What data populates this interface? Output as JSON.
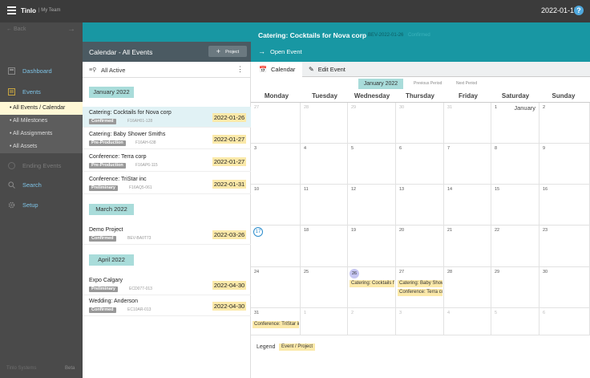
{
  "topbar": {
    "app_name": "Tinlo",
    "team": "| My Team",
    "date": "2022-01-17",
    "help": "?"
  },
  "sidebar": {
    "back": "Back",
    "items": [
      {
        "label": "Dashboard"
      },
      {
        "label": "Events"
      },
      {
        "label": "Ending Events"
      },
      {
        "label": "Search"
      },
      {
        "label": "Setup"
      }
    ],
    "subitems": [
      {
        "label": "All Events / Calendar"
      },
      {
        "label": "All Milestones"
      },
      {
        "label": "All Assignments"
      },
      {
        "label": "All Assets"
      }
    ],
    "footer_left": "Tinlo Systems",
    "footer_right": "Beta"
  },
  "banner": {
    "title": "Catering: Cocktails for Nova corp",
    "sub1": "BEV-2022-01-26",
    "sub2": "Confirmed",
    "open_label": "Open Event"
  },
  "list": {
    "title": "Calendar - All Events",
    "project_button": "Project",
    "filter_label": "All Active",
    "groups": [
      {
        "month": "January 2022",
        "events": [
          {
            "name": "Catering: Cocktails for Nova corp",
            "status": "Confirmed",
            "code": "F16AH01-128",
            "date": "2022-01-26"
          },
          {
            "name": "Catering: Baby Shower Smiths",
            "status": "Pre-Production",
            "code": "F16AH-638",
            "date": "2022-01-27"
          },
          {
            "name": "Conference: Terra corp",
            "status": "Pre-Production",
            "code": "F16AP6-115",
            "date": "2022-01-27"
          },
          {
            "name": "Conference: TriStar inc",
            "status": "Preliminary",
            "code": "F16AQ5-061",
            "date": "2022-01-31"
          }
        ]
      },
      {
        "month": "March 2022",
        "events": [
          {
            "name": "Demo Project",
            "status": "Confirmed",
            "code": "BEV-BA0T73",
            "date": "2022-03-26"
          }
        ]
      },
      {
        "month": "April 2022",
        "events": [
          {
            "name": "Expo Calgary",
            "status": "Preliminary",
            "code": "ECD077-013",
            "date": "2022-04-30"
          },
          {
            "name": "Wedding: Anderson",
            "status": "Confirmed",
            "code": "EC10AR-013",
            "date": "2022-04-30"
          }
        ]
      }
    ]
  },
  "calendar": {
    "tabs": [
      {
        "label": "Calendar"
      },
      {
        "label": "Edit Event"
      }
    ],
    "current_period": "January 2022",
    "prev_label": "Previous Period",
    "next_label": "Next Period",
    "day_names": [
      "Monday",
      "Tuesday",
      "Wednesday",
      "Thursday",
      "Friday",
      "Saturday",
      "Sunday"
    ],
    "month_label": "January",
    "weeks": [
      [
        "27",
        "28",
        "29",
        "30",
        "31",
        "1",
        "2"
      ],
      [
        "3",
        "4",
        "5",
        "6",
        "7",
        "8",
        "9"
      ],
      [
        "10",
        "11",
        "12",
        "13",
        "14",
        "15",
        "16"
      ],
      [
        "17",
        "18",
        "19",
        "20",
        "21",
        "22",
        "23"
      ],
      [
        "24",
        "25",
        "26",
        "27",
        "28",
        "29",
        "30"
      ],
      [
        "31",
        "1",
        "2",
        "3",
        "4",
        "5",
        "6"
      ]
    ],
    "chips": {
      "c26": "Catering: Cocktails for Nova corp",
      "c27a": "Catering: Baby Shower Smiths",
      "c27b": "Conference: Terra corp",
      "c31": "Conference: TriStar inc"
    },
    "legend_label": "Legend",
    "legend_chip": "Event / Project"
  }
}
